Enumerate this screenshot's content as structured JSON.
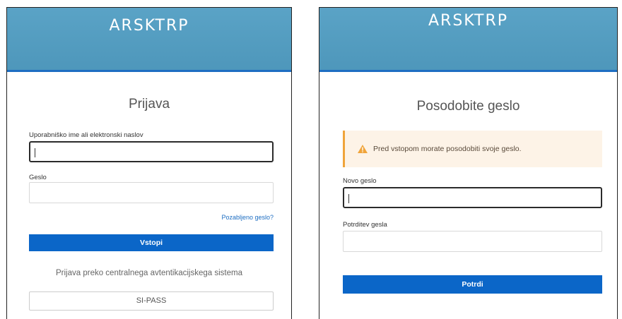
{
  "login": {
    "brand": "ARSKTRP",
    "title": "Prijava",
    "username_label": "Uporabniško ime ali elektronski naslov",
    "username_value": "",
    "password_label": "Geslo",
    "password_value": "",
    "forgot_link": "Pozabljeno geslo?",
    "submit_label": "Vstopi",
    "sso_text": "Prijava preko centralnega avtentikacijskega sistema",
    "sso_button_label": "SI-PASS"
  },
  "update_password": {
    "brand": "ARSKTRP",
    "title": "Posodobite geslo",
    "alert_text": "Pred vstopom morate posodobiti svoje geslo.",
    "new_password_label": "Novo geslo",
    "new_password_value": "",
    "confirm_password_label": "Potrditev gesla",
    "confirm_password_value": "",
    "submit_label": "Potrdi"
  },
  "colors": {
    "header": "#5aa3c6",
    "accent_blue": "#0b66c8",
    "warning": "#f0a43a",
    "alert_bg": "#fdf3e7"
  },
  "icons": {
    "alert": "warning-triangle-icon"
  }
}
